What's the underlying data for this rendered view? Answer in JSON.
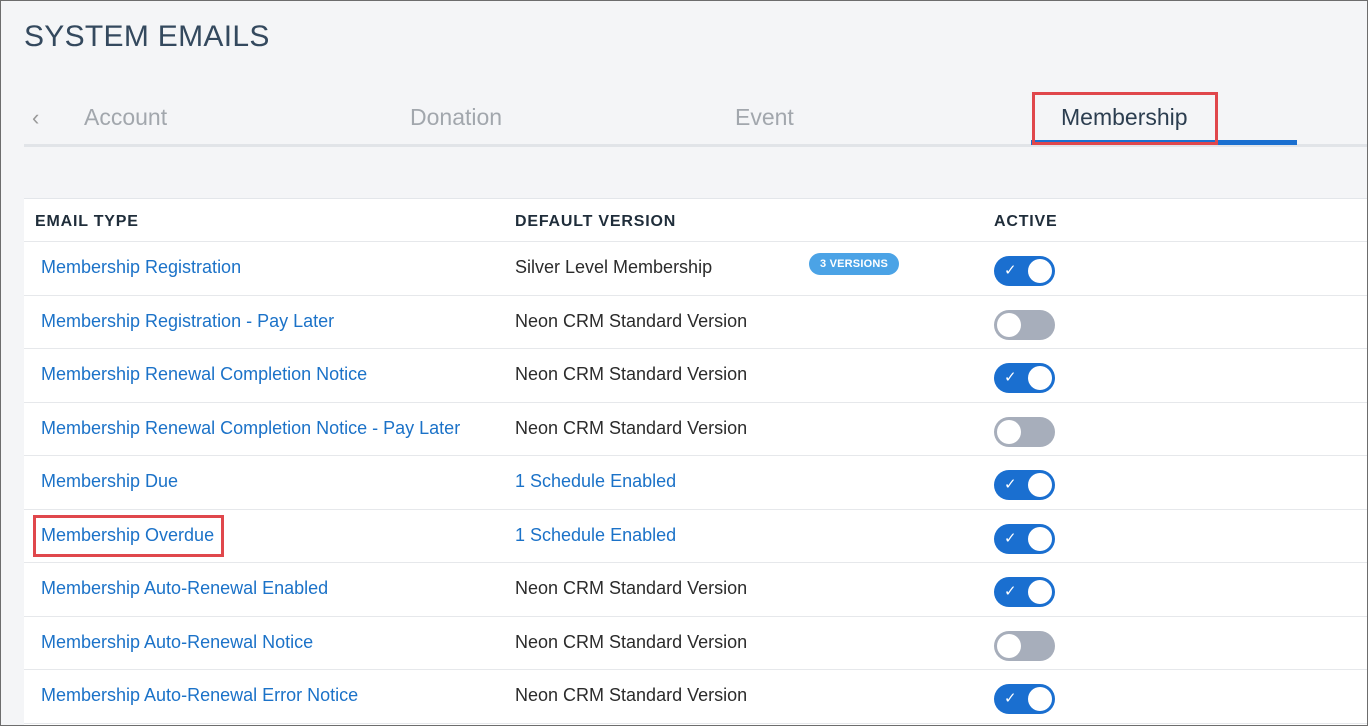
{
  "page": {
    "title": "SYSTEM EMAILS"
  },
  "tabs": {
    "prev_icon": "chevron-left-icon",
    "items": [
      {
        "label": "Account",
        "active": false
      },
      {
        "label": "Donation",
        "active": false
      },
      {
        "label": "Event",
        "active": false
      },
      {
        "label": "Membership",
        "active": true
      }
    ]
  },
  "table": {
    "headers": {
      "type": "EMAIL TYPE",
      "version": "DEFAULT VERSION",
      "active": "ACTIVE"
    },
    "rows": [
      {
        "type": "Membership Registration",
        "version": "Silver Level Membership",
        "version_link": false,
        "badge": "3 VERSIONS",
        "active": true
      },
      {
        "type": "Membership Registration - Pay Later",
        "version": "Neon CRM Standard Version",
        "version_link": false,
        "active": false
      },
      {
        "type": "Membership Renewal Completion Notice",
        "version": "Neon CRM Standard Version",
        "version_link": false,
        "active": true
      },
      {
        "type": "Membership Renewal Completion Notice - Pay Later",
        "version": "Neon CRM Standard Version",
        "version_link": false,
        "active": false
      },
      {
        "type": "Membership Due",
        "version": "1 Schedule Enabled",
        "version_link": true,
        "active": true
      },
      {
        "type": "Membership Overdue",
        "version": "1 Schedule Enabled",
        "version_link": true,
        "active": true
      },
      {
        "type": "Membership Auto-Renewal Enabled",
        "version": "Neon CRM Standard Version",
        "version_link": false,
        "active": true
      },
      {
        "type": "Membership Auto-Renewal Notice",
        "version": "Neon CRM Standard Version",
        "version_link": false,
        "active": false
      },
      {
        "type": "Membership Auto-Renewal Error Notice",
        "version": "Neon CRM Standard Version",
        "version_link": false,
        "active": true
      }
    ]
  },
  "colors": {
    "accent": "#1a6fd0",
    "link": "#1b72c8",
    "toggle_off": "#a7aebb",
    "badge": "#4ba3e6",
    "highlight": "#e0474c"
  }
}
